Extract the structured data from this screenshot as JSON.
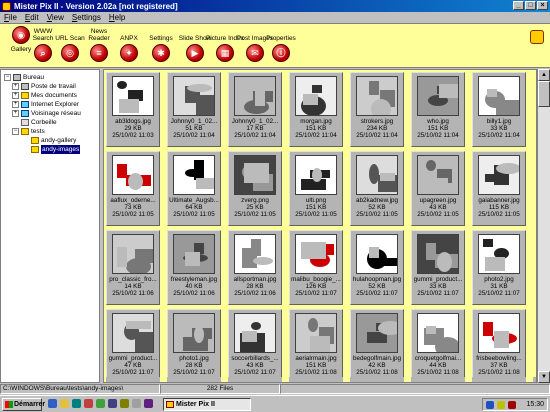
{
  "window": {
    "title": "Mister Pix II - Version 2.02a [not registered]"
  },
  "menu": [
    "File",
    "Edit",
    "View",
    "Settings",
    "Help"
  ],
  "toolbar": [
    {
      "label": "Gallery",
      "icon": "gallery-icon"
    },
    {
      "label": "WWW Search",
      "icon": "www-search-icon"
    },
    {
      "label": "URL Scan",
      "icon": "url-scan-icon"
    },
    {
      "label": "News Reader",
      "icon": "news-reader-icon"
    },
    {
      "label": "ANPX",
      "icon": "anpx-icon"
    },
    {
      "label": "Settings",
      "icon": "settings-icon"
    },
    {
      "label": "Slide Show",
      "icon": "slide-show-icon"
    },
    {
      "label": "Picture Index",
      "icon": "picture-index-icon"
    },
    {
      "label": "Post Images",
      "icon": "post-images-icon"
    },
    {
      "label": "Properties",
      "icon": "properties-icon"
    }
  ],
  "tree": [
    {
      "label": "Bureau",
      "level": 0,
      "pm": "-",
      "kind": "pc"
    },
    {
      "label": "Poste de travail",
      "level": 1,
      "pm": "+",
      "kind": "pc"
    },
    {
      "label": "Mes documents",
      "level": 1,
      "pm": "+",
      "kind": "folder"
    },
    {
      "label": "Internet Explorer",
      "level": 1,
      "pm": "+",
      "kind": "net"
    },
    {
      "label": "Voisinage réseau",
      "level": 1,
      "pm": "+",
      "kind": "net"
    },
    {
      "label": "Corbeille",
      "level": 1,
      "pm": "",
      "kind": "bin"
    },
    {
      "label": "tests",
      "level": 1,
      "pm": "-",
      "kind": "folder"
    },
    {
      "label": "andy-gallery",
      "level": 2,
      "pm": "",
      "kind": "folder"
    },
    {
      "label": "andy-images",
      "level": 2,
      "pm": "",
      "kind": "folder",
      "selected": true
    }
  ],
  "thumbnails": [
    {
      "name": "ab3ldogs.jpg",
      "size": "29 KB",
      "date": "25/10/02 11:03"
    },
    {
      "name": "Johnny0_1_02...",
      "size": "51 KB",
      "date": "25/10/02 11:04"
    },
    {
      "name": "Johnny0_1_02...",
      "size": "17 KB",
      "date": "25/10/02 11:04"
    },
    {
      "name": "morgan.jpg",
      "size": "151 KB",
      "date": "25/10/02 11:04"
    },
    {
      "name": "strokers.jpg",
      "size": "234 KB",
      "date": "25/10/02 11:04"
    },
    {
      "name": "who.jpg",
      "size": "151 KB",
      "date": "25/10/02 11:04"
    },
    {
      "name": "billy1.jpg",
      "size": "33 KB",
      "date": "25/10/02 11:04"
    },
    {
      "name": "aaflux_oderne...",
      "size": "73 KB",
      "date": "25/10/02 11:05"
    },
    {
      "name": "Ultimate_Augsb...",
      "size": "64 KB",
      "date": "25/10/02 11:05"
    },
    {
      "name": "zverg.png",
      "size": "25 KB",
      "date": "25/10/02 11:05"
    },
    {
      "name": "ulti.png",
      "size": "151 KB",
      "date": "25/10/02 11:05"
    },
    {
      "name": "ab2kadnew.jpg",
      "size": "52 KB",
      "date": "25/10/02 11:05"
    },
    {
      "name": "upagreen.jpg",
      "size": "43 KB",
      "date": "25/10/02 11:05"
    },
    {
      "name": "gaiabanner.jpg",
      "size": "115 KB",
      "date": "25/10/02 11:05"
    },
    {
      "name": "pro_classic_fro...",
      "size": "14 KB",
      "date": "25/10/02 11:06"
    },
    {
      "name": "freestyleman.jpg",
      "size": "40 KB",
      "date": "25/10/02 11:06"
    },
    {
      "name": "allsportman.jpg",
      "size": "28 KB",
      "date": "25/10/02 11:06"
    },
    {
      "name": "malibu_boogie_...",
      "size": "126 KB",
      "date": "25/10/02 11:07"
    },
    {
      "name": "hulahoopman.jpg",
      "size": "52 KB",
      "date": "25/10/02 11:07"
    },
    {
      "name": "gummi_product...",
      "size": "33 KB",
      "date": "25/10/02 11:07"
    },
    {
      "name": "photo2.jpg",
      "size": "31 KB",
      "date": "25/10/02 11:07"
    },
    {
      "name": "gummi_product...",
      "size": "47 KB",
      "date": "25/10/02 11:07"
    },
    {
      "name": "photo1.jpg",
      "size": "28 KB",
      "date": "25/10/02 11:07"
    },
    {
      "name": "soccerbillards_...",
      "size": "43 KB",
      "date": "25/10/02 11:07"
    },
    {
      "name": "aerialrmain.jpg",
      "size": "151 KB",
      "date": "25/10/02 11:08"
    },
    {
      "name": "bedegolfmain.jpg",
      "size": "42 KB",
      "date": "25/10/02 11:08"
    },
    {
      "name": "croquetgolfmai...",
      "size": "44 KB",
      "date": "25/10/02 11:08"
    },
    {
      "name": "frisbeebowling...",
      "size": "37 KB",
      "date": "25/10/02 11:08"
    }
  ],
  "status": {
    "path": "C:\\WINDOWS\\Bureau\\tests\\andy-images\\",
    "count": "282 Files"
  },
  "taskbar": {
    "start": "Démarrer",
    "task": "Mister Pix II",
    "clock": "15:30"
  }
}
